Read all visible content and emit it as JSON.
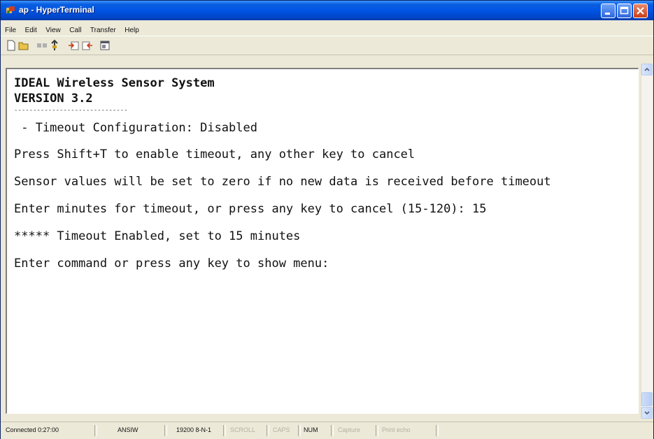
{
  "window": {
    "title": "ap - HyperTerminal",
    "controls": [
      "minimize",
      "maximize",
      "close"
    ],
    "colors": {
      "titlebar": "#0054e3",
      "terminal_bg": "#ffffff",
      "chrome": "#ece9d8"
    }
  },
  "menu": [
    "File",
    "Edit",
    "View",
    "Call",
    "Transfer",
    "Help"
  ],
  "toolbar": {
    "icons": [
      "new-connection-icon",
      "open-icon",
      "disconnect-icon",
      "connect-icon",
      "send-icon",
      "receive-icon",
      "properties-icon"
    ]
  },
  "terminal": {
    "header_title": "IDEAL Wireless Sensor System",
    "header_version": "VERSION 3.2",
    "separator": "------------------------------",
    "lines": [
      " - Timeout Configuration: Disabled",
      "Press Shift+T to enable timeout, any other key to cancel",
      "Sensor values will be set to zero if no new data is received before timeout",
      "Enter minutes for timeout, or press any key to cancel (15-120): 15",
      "***** Timeout Enabled, set to 15 minutes",
      "Enter command or press any key to show menu:"
    ]
  },
  "status": {
    "connected": "Connected 0:27:00",
    "emulation": "ANSIW",
    "port_settings": "19200 8-N-1",
    "scroll": "SCROLL",
    "caps": "CAPS",
    "num": "NUM",
    "capture": "Capture",
    "print_echo": "Print echo"
  }
}
